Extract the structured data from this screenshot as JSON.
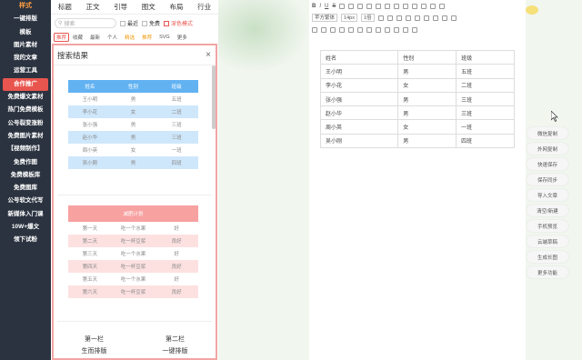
{
  "sidebar": {
    "brand": "样式",
    "items": [
      "一键排版",
      "模板",
      "图片素材",
      "我的文章",
      "运营工具",
      "合作推广",
      "免费爆文素材",
      "热门免费模板",
      "公号裂变涨粉",
      "免费图片素材",
      "【视频制作】",
      "免费作图",
      "免费模板库",
      "免费图库",
      "公号软文代写",
      "新媒体入门课",
      "10W+爆文",
      "领下试粉"
    ]
  },
  "tabs": [
    "标题",
    "正文",
    "引导",
    "图文",
    "布局",
    "行业"
  ],
  "search": {
    "placeholder": "搜索",
    "opt_recent": "最近",
    "opt_free": "免费",
    "opt_mode": "深色模式"
  },
  "filters": [
    "推荐",
    "收藏",
    "最新",
    "个人",
    "精选",
    "推荐",
    "SVG",
    "更多"
  ],
  "panel": {
    "title": "搜索结果",
    "close": "×",
    "table1": {
      "headers": [
        "姓名",
        "性别",
        "班级"
      ],
      "rows": [
        [
          "王小明",
          "男",
          "五班"
        ],
        [
          "李小花",
          "女",
          "二班"
        ],
        [
          "张小强",
          "男",
          "三班"
        ],
        [
          "赵小华",
          "男",
          "三班"
        ],
        [
          "周小英",
          "女",
          "一班"
        ],
        [
          "吴小刚",
          "男",
          "四班"
        ]
      ]
    },
    "table2": {
      "header": "减肥计划",
      "rows": [
        [
          "第一天",
          "吃一个水果",
          "好"
        ],
        [
          "第二天",
          "吃一杯豆浆",
          "良好"
        ],
        [
          "第三天",
          "吃一个水果",
          "好"
        ],
        [
          "第四天",
          "吃一杯豆浆",
          "良好"
        ],
        [
          "第五天",
          "吃一个水果",
          "好"
        ],
        [
          "第六天",
          "吃一杯豆浆",
          "良好"
        ]
      ]
    },
    "bottom": [
      [
        "第一栏",
        "第二栏"
      ],
      [
        "生而排版",
        "一键排版"
      ]
    ]
  },
  "toolbar": {
    "font": "苹方繁体",
    "size": "14px",
    "spacing": "1倍"
  },
  "doc_table": [
    [
      "姓名",
      "性别",
      "班级"
    ],
    [
      "王小明",
      "男",
      "五班"
    ],
    [
      "李小花",
      "女",
      "二班"
    ],
    [
      "张小强",
      "男",
      "三班"
    ],
    [
      "赵小华",
      "男",
      "三班"
    ],
    [
      "周小英",
      "女",
      "一班"
    ],
    [
      "吴小刚",
      "男",
      "四班"
    ]
  ],
  "right_menu": [
    "微信复制",
    "外网复制",
    "快速保存",
    "保存同步",
    "导入文章",
    "清空/新建",
    "手机预览",
    "云端草稿",
    "生成长图",
    "更多功能"
  ]
}
